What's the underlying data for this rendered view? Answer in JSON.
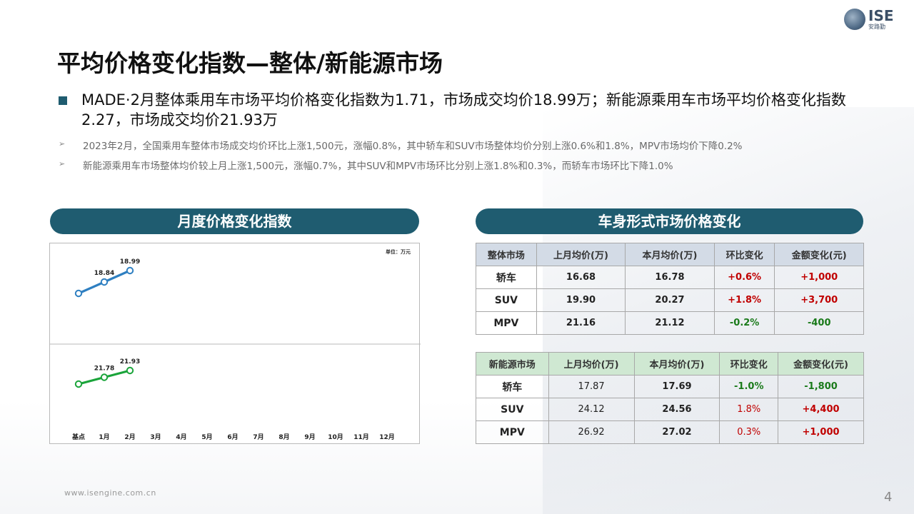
{
  "logo": {
    "text": "ISE",
    "sub": "安路勤"
  },
  "title": "平均价格变化指数—整体/新能源市场",
  "main_bullet": "MADE·2月整体乘用车市场平均价格变化指数为1.71，市场成交均价18.99万；新能源乘用车市场平均价格变化指数2.27，市场成交均价21.93万",
  "sub_bullets": [
    "2023年2月，全国乘用车整体市场成交均价环比上涨1,500元，涨幅0.8%，其中轿车和SUV市场整体均价分别上涨0.6%和1.8%，MPV市场均价下降0.2%",
    "新能源乘用车市场整体均价较上月上涨1,500元，涨幅0.7%，其中SUV和MPV市场环比分别上涨1.8%和0.3%，而轿车市场环比下降1.0%"
  ],
  "arrow_glyph": "➢",
  "left_pill": "月度价格变化指数",
  "right_pill": "车身形式市场价格变化",
  "chart_data": {
    "type": "line",
    "unit_label": "单位：万元",
    "categories": [
      "基点",
      "1月",
      "2月",
      "3月",
      "4月",
      "5月",
      "6月",
      "7月",
      "8月",
      "9月",
      "10月",
      "11月",
      "12月"
    ],
    "series": [
      {
        "values": [
          null,
          18.84,
          18.99
        ],
        "color": "#2e7fc1",
        "start_marker": true
      },
      {
        "values": [
          null,
          21.78,
          21.93
        ],
        "color": "#1aa43a",
        "start_marker": true
      }
    ],
    "data_labels": [
      [
        "",
        "18.84",
        "18.99"
      ],
      [
        "",
        "21.78",
        "21.93"
      ]
    ]
  },
  "table_overall": {
    "headers": [
      "整体市场",
      "上月均价(万)",
      "本月均价(万)",
      "环比变化",
      "金额变化(元)"
    ],
    "rows": [
      [
        "轿车",
        "16.68",
        "16.78",
        "+0.6%",
        "+1,000"
      ],
      [
        "SUV",
        "19.90",
        "20.27",
        "+1.8%",
        "+3,700"
      ],
      [
        "MPV",
        "21.16",
        "21.12",
        "-0.2%",
        "-400"
      ]
    ]
  },
  "table_nev": {
    "headers": [
      "新能源市场",
      "上月均价(万)",
      "本月均价(万)",
      "环比变化",
      "金额变化(元)"
    ],
    "rows": [
      [
        "轿车",
        "17.87",
        "17.69",
        "-1.0%",
        "-1,800"
      ],
      [
        "SUV",
        "24.12",
        "24.56",
        "1.8%",
        "+4,400"
      ],
      [
        "MPV",
        "26.92",
        "27.02",
        "0.3%",
        "+1,000"
      ]
    ]
  },
  "colors": {
    "accent": "#1f5c70",
    "up": "#c00000",
    "down": "#1a7a1a"
  },
  "footer_url": "www.isengine.com.cn",
  "page_number": "4"
}
